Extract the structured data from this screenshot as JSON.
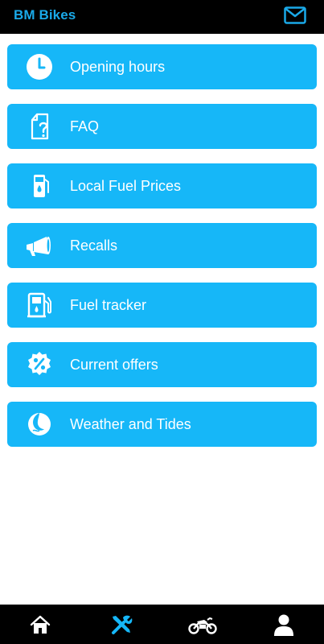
{
  "header": {
    "title": "BM Bikes",
    "mail_icon": "mail-icon"
  },
  "menu": {
    "items": [
      {
        "label": "Opening hours",
        "icon": "clock-icon"
      },
      {
        "label": "FAQ",
        "icon": "faq-document-icon"
      },
      {
        "label": "Local Fuel Prices",
        "icon": "fuel-pump-icon"
      },
      {
        "label": "Recalls",
        "icon": "megaphone-icon"
      },
      {
        "label": "Fuel tracker",
        "icon": "fuel-station-icon"
      },
      {
        "label": "Current offers",
        "icon": "percent-badge-icon"
      },
      {
        "label": "Weather and Tides",
        "icon": "weather-icon"
      }
    ]
  },
  "bottom_nav": {
    "items": [
      {
        "icon": "home-icon",
        "active": false
      },
      {
        "icon": "tools-icon",
        "active": true
      },
      {
        "icon": "motorcycle-icon",
        "active": false
      },
      {
        "icon": "user-icon",
        "active": false
      }
    ]
  },
  "colors": {
    "accent": "#16b7f8",
    "title": "#1aa9e8",
    "bar": "#000000",
    "text_on_accent": "#ffffff"
  }
}
